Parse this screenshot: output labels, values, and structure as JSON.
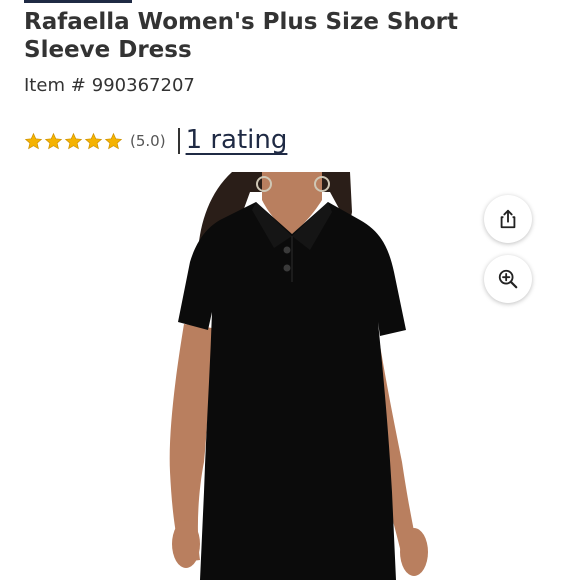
{
  "product": {
    "title_line1": "Rafaella Women's Plus Size Short",
    "title_line2": "Sleeve Dress",
    "item_label": "Item #",
    "item_number": "990367207"
  },
  "rating": {
    "stars": 5,
    "max_stars": 5,
    "value_text": "(5.0)",
    "count_text": "1 rating",
    "star_color": "#f5b301"
  },
  "image": {
    "alt": "Black short sleeve polo dress"
  },
  "actions": {
    "share_icon": "share-icon",
    "zoom_icon": "zoom-in-icon"
  }
}
